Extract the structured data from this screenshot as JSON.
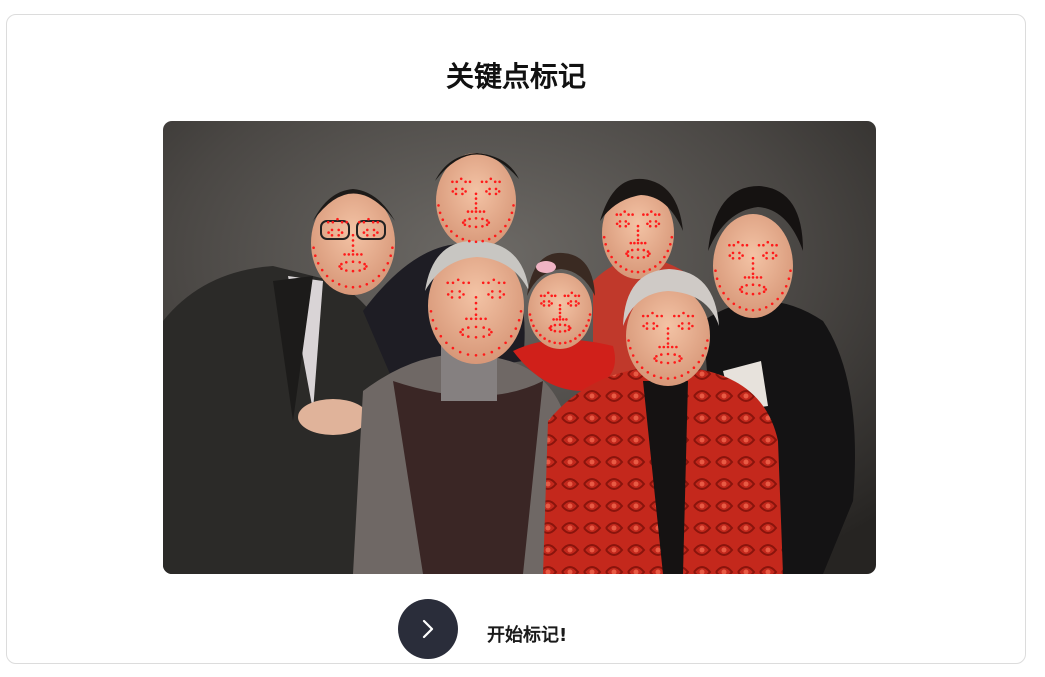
{
  "page": {
    "title": "关键点标记"
  },
  "photo": {
    "description_icon": "group-photo-with-face-landmarks"
  },
  "actions": {
    "start_label": "开始标记!",
    "start_icon": "chevron-right-icon"
  },
  "colors": {
    "landmark": "#ff1a1a",
    "button": "#2a2d3a"
  }
}
